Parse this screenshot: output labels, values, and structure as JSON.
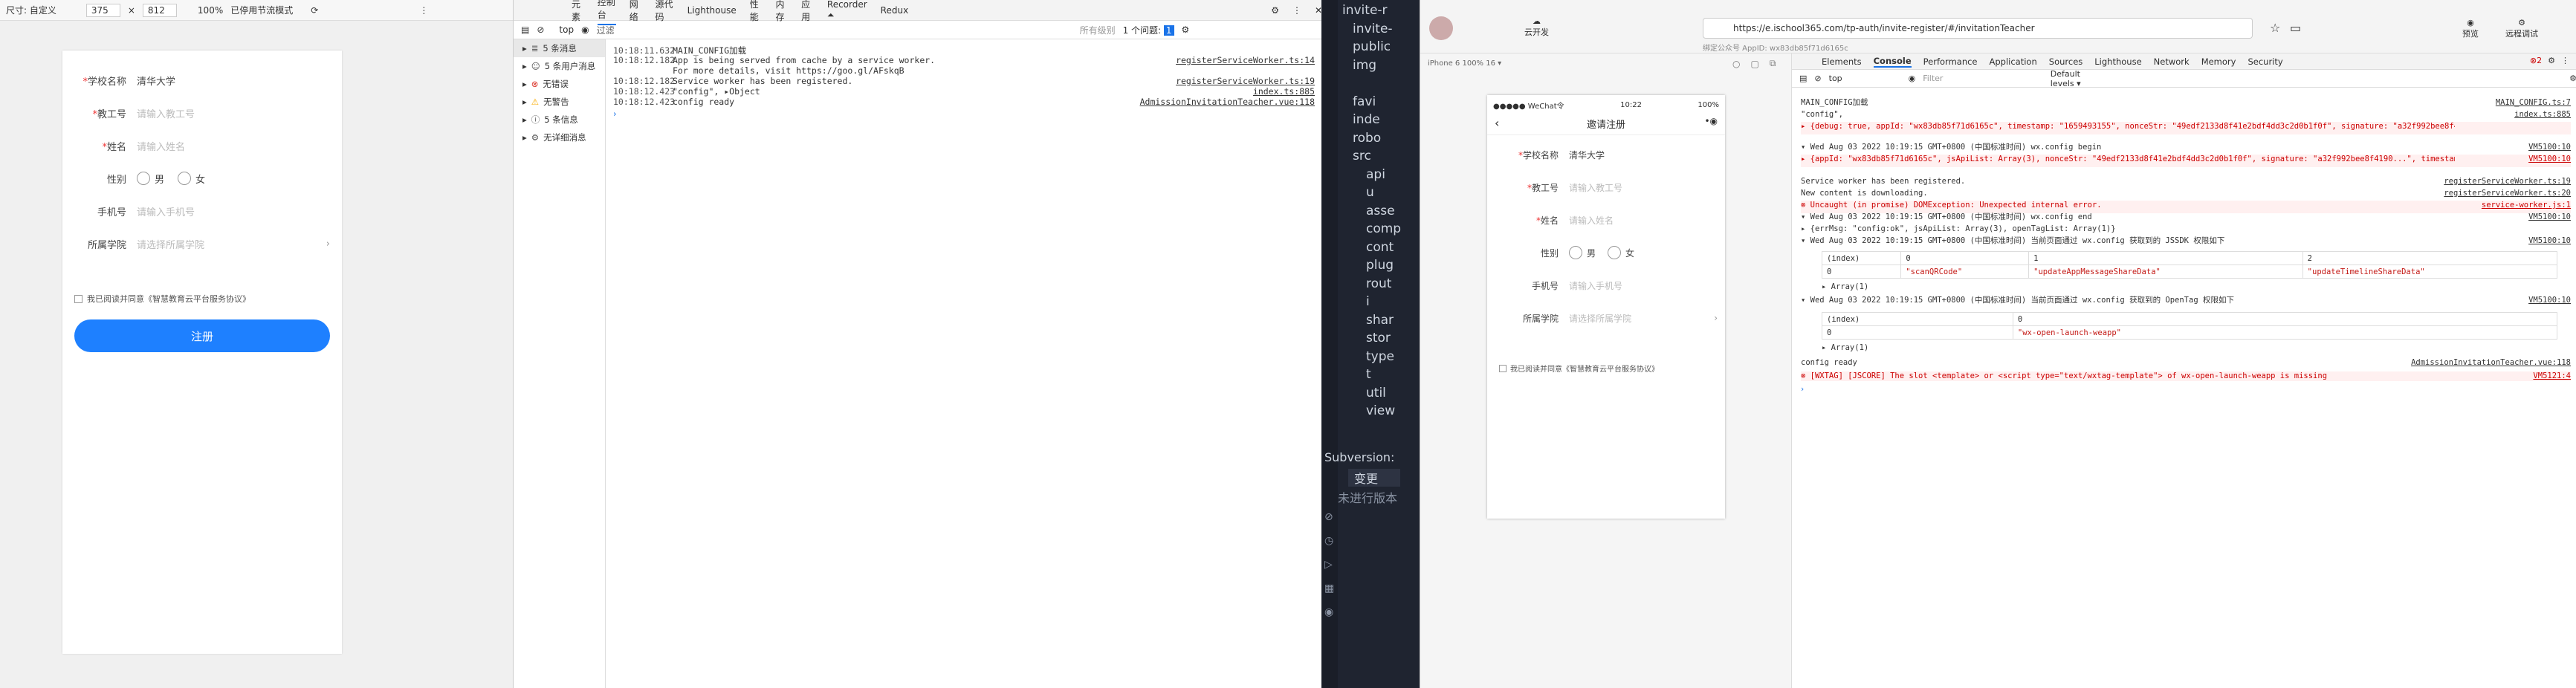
{
  "left_sim": {
    "toolbar": {
      "dimensions": "尺寸: 自定义",
      "width": "375",
      "height": "812",
      "zoom": "100%",
      "throttle": "已停用节流模式"
    },
    "form": {
      "school_label": "学校名称",
      "school_value": "清华大学",
      "teacher_no_label": "教工号",
      "teacher_no_ph": "请输入教工号",
      "name_label": "姓名",
      "name_ph": "请输入姓名",
      "gender_label": "性别",
      "male": "男",
      "female": "女",
      "phone_label": "手机号",
      "phone_ph": "请输入手机号",
      "college_label": "所属学院",
      "college_ph": "请选择所属学院",
      "agree": "我已阅读并同意《智慧教育云平台服务协议》",
      "submit": "注册"
    }
  },
  "devtools_left": {
    "tabs": [
      "元素",
      "控制台",
      "网络",
      "源代码",
      "Lighthouse",
      "性能",
      "内存",
      "应用",
      "Recorder ⏶",
      "Redux"
    ],
    "badge": "1",
    "filter_ph": "过滤",
    "top": "top",
    "levels": "所有级别",
    "issues": "1 个问题: ",
    "side": [
      {
        "label": "5 条消息",
        "icon": "list-icon"
      },
      {
        "label": "5 条用户消息",
        "icon": "user-icon"
      },
      {
        "label": "无错误",
        "icon": "error-icon"
      },
      {
        "label": "无警告",
        "icon": "warning-icon"
      },
      {
        "label": "5 条信息",
        "icon": "info-icon"
      },
      {
        "label": "无详细消息",
        "icon": "verbose-icon"
      }
    ],
    "logs": [
      {
        "time": "10:18:11.632",
        "msg": "MAIN_CONFIG加载",
        "src": ""
      },
      {
        "time": "10:18:12.182",
        "msg": "App is being served from cache by a service worker.",
        "src": "registerServiceWorker.ts:14"
      },
      {
        "time": "",
        "msg": "For more details, visit https://goo.gl/AFskqB",
        "src": ""
      },
      {
        "time": "10:18:12.182",
        "msg": "Service worker has been registered.",
        "src": "registerServiceWorker.ts:19"
      },
      {
        "time": "10:18:12.423",
        "msg": "\"config\", ▸Object",
        "src": "index.ts:885"
      },
      {
        "time": "10:18:12.423",
        "msg": "config ready",
        "src": "AdmissionInvitationTeacher.vue:118"
      }
    ]
  },
  "vscode": {
    "tree": [
      "invite-r",
      "invite-",
      "public",
      "img",
      "",
      "favi",
      "inde",
      "robo",
      "src",
      "api",
      "u",
      "asse",
      "comp",
      "cont",
      "plug",
      "rout",
      "i",
      "shar",
      "stor",
      "type",
      "t",
      "util",
      "view"
    ],
    "svn_title": "Subversion:",
    "svn_change": "变更",
    "svn_uncommitted": "未进行版本"
  },
  "big": {
    "tabs_top": [
      "云开发"
    ],
    "url": "https://e.ischool365.com/tp-auth/invite-register/#/invitationTeacher",
    "appid": "绑定公众号 AppID: wx83db85f71d6165c",
    "preview": "预览",
    "remote": "远程调试",
    "device": "iPhone 6 100% 16 ▾",
    "phone": {
      "carrier": "●●●●● WeChat令",
      "time": "10:22",
      "battery": "100%",
      "title": "邀请注册"
    },
    "con_tabs": [
      "Elements",
      "Console",
      "Performance",
      "Application",
      "Sources",
      "Lighthouse",
      "Network",
      "Memory",
      "Security"
    ],
    "con_filter": "Filter",
    "con_top": "top",
    "con_levels": "Default levels ▾",
    "errors": "2",
    "lines": [
      {
        "t": "MAIN_CONFIG加载",
        "s": "MAIN_CONFIG.ts:7",
        "k": ""
      },
      {
        "t": "\"config\",",
        "s": "index.ts:885",
        "k": ""
      },
      {
        "t": "  ▸ {debug: true, appId: \"wx83db85f71d6165c\", timestamp: \"1659493155\", nonceStr: \"49edf2133d8f41e2bdf4dd3c2d0b1f0f\", signature: \"a32f992bee8f4190...\", …}",
        "s": "",
        "k": "err"
      },
      {
        "t": "▾ Wed Aug 03 2022 10:19:15 GMT+0800 (中国标准时间) wx.config begin",
        "s": "VM5100:10",
        "k": ""
      },
      {
        "t": "  ▸ {appId: \"wx83db85f71d6165c\", jsApiList: Array(3), nonceStr: \"49edf2133d8f41e2bdf4dd3c2d0b1f0f\", signature: \"a32f992bee8f4190...\", timestamp: \"1659493155\", …}",
        "s": "VM5100:10",
        "k": "err"
      },
      {
        "t": "Service worker has been registered.",
        "s": "registerServiceWorker.ts:19",
        "k": ""
      },
      {
        "t": "New content is downloading.",
        "s": "registerServiceWorker.ts:20",
        "k": ""
      },
      {
        "t": "⊗ Uncaught (in promise) DOMException: Unexpected internal error.",
        "s": "service-worker.js:1",
        "k": "err"
      },
      {
        "t": "▾ Wed Aug 03 2022 10:19:15 GMT+0800 (中国标准时间) wx.config end",
        "s": "VM5100:10",
        "k": ""
      },
      {
        "t": "  ▸ {errMsg: \"config:ok\", jsApiList: Array(3), openTagList: Array(1)}",
        "s": "",
        "k": ""
      },
      {
        "t": "▾ Wed Aug 03 2022 10:19:15 GMT+0800 (中国标准时间) 当前页面通过 wx.config 获取到的 JSSDK 权限如下",
        "s": "VM5100:10",
        "k": ""
      }
    ],
    "table1": {
      "head": [
        "(index)",
        "0",
        "1",
        "2"
      ],
      "row": [
        "0",
        "\"scanQRCode\"",
        "\"updateAppMessageShareData\"",
        "\"updateTimelineShareData\""
      ]
    },
    "arr1": "▸ Array(1)",
    "opentag": "▾ Wed Aug 03 2022 10:19:15 GMT+0800 (中国标准时间) 当前页面通过 wx.config 获取到的 OpenTag 权限如下",
    "opentag_src": "VM5100:10",
    "table2": {
      "head": [
        "(index)",
        "0"
      ],
      "row": [
        "0",
        "\"wx-open-launch-weapp\""
      ]
    },
    "ready": "config ready",
    "ready_src": "AdmissionInvitationTeacher.vue:118",
    "wxtag": "⊗ [WXTAG] [JSCORE] The slot <template> or <script type=\"text/wxtag-template\"> of wx-open-launch-weapp is missing",
    "wxtag_src": "VM5121:4"
  }
}
